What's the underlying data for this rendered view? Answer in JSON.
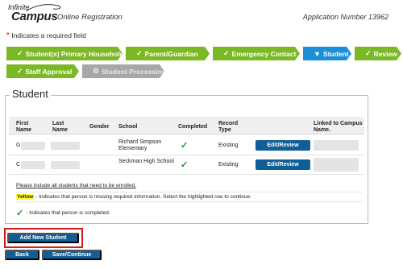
{
  "header": {
    "logo_line1": "Infinite",
    "logo_line2": "Campus",
    "subtitle": "Online Registration",
    "application_number": "Application Number 13962"
  },
  "required_note": {
    "star": "*",
    "text": "Indicates a required field"
  },
  "steps": [
    {
      "label": "Student(s) Primary Household",
      "status": "complete",
      "icon": "check-icon"
    },
    {
      "label": "Parent/Guardian",
      "status": "complete",
      "icon": "check-icon"
    },
    {
      "label": "Emergency Contact",
      "status": "complete",
      "icon": "check-icon"
    },
    {
      "label": "Student",
      "status": "active",
      "icon": "chevron-down-icon"
    },
    {
      "label": "Review",
      "status": "complete",
      "icon": "check-icon"
    },
    {
      "label": "Staff Approval",
      "status": "complete",
      "icon": "check-icon"
    },
    {
      "label": "Student Processing",
      "status": "disabled",
      "icon": "gear-icon"
    }
  ],
  "student_section": {
    "title": "Student",
    "columns": [
      "First Name",
      "Last Name",
      "Gender",
      "School",
      "Completed",
      "Record Type",
      "",
      "Linked to Campus Name."
    ],
    "rows": [
      {
        "first_initial": "G",
        "school": "Richard Simpson Elementary",
        "completed": "✓",
        "record_type": "Existing",
        "action": "Edit/Review"
      },
      {
        "first_initial": "C",
        "school": "Seckman High School",
        "completed": "✓",
        "record_type": "Existing",
        "action": "Edit/Review"
      }
    ]
  },
  "notes": {
    "enroll": "Please include all students that need to be enrolled.",
    "yellow_word": "Yellow",
    "yellow_text": " - Indicates that person is missing required information. Select the highlighted row to continue.",
    "check_symbol": "✓",
    "completed_text": " - Indicates that person is completed."
  },
  "buttons": {
    "add_new_student": "Add New Student",
    "back": "Back",
    "save_continue": "Save/Continue"
  },
  "colors": {
    "step_complete": "#7bb825",
    "step_active": "#1e8fd6",
    "step_disabled": "#a7a7a7",
    "button": "#0f5f96",
    "highlight": "#d31b1b"
  }
}
